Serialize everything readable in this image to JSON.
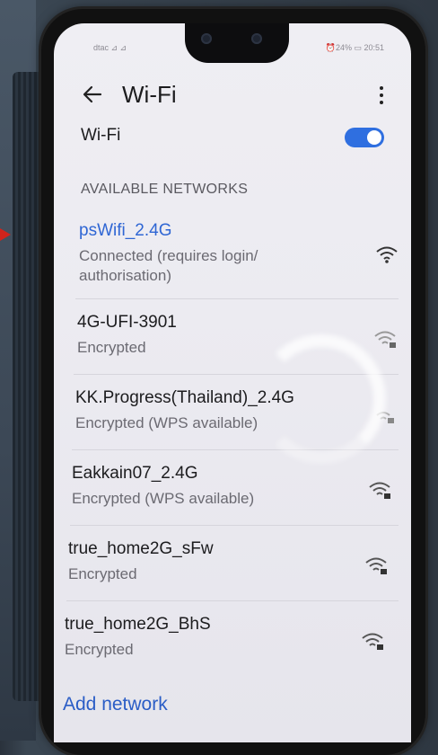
{
  "status_bar": {
    "left": "dtac ⊿ ⊿",
    "right": "⏰24% ▭ 20:51"
  },
  "app_bar": {
    "title": "Wi-Fi"
  },
  "wifi_switch": {
    "label": "Wi-Fi",
    "on": true
  },
  "section_title": "AVAILABLE NETWORKS",
  "networks": [
    {
      "name": "psWifi_2.4G",
      "status": "Connected (requires login/ authorisation)",
      "icon": "wifi-signal-icon"
    },
    {
      "name": "4G-UFI-3901",
      "status": "Encrypted",
      "icon": "wifi-lock-icon"
    },
    {
      "name": "KK.Progress(Thailand)_2.4G",
      "status": "Encrypted (WPS available)",
      "icon": "wifi-lock-icon"
    },
    {
      "name": "Eakkain07_2.4G",
      "status": "Encrypted (WPS available)",
      "icon": "wifi-lock-icon"
    },
    {
      "name": "true_home2G_sFw",
      "status": "Encrypted",
      "icon": "wifi-lock-icon"
    },
    {
      "name": "true_home2G_BhS",
      "status": "Encrypted",
      "icon": "wifi-lock-icon"
    }
  ],
  "add_network_label": "Add network",
  "colors": {
    "accent": "#2f6fe0",
    "active_network": "#2f66d4",
    "link": "#2a5dc6",
    "marker": "#d0241c"
  }
}
